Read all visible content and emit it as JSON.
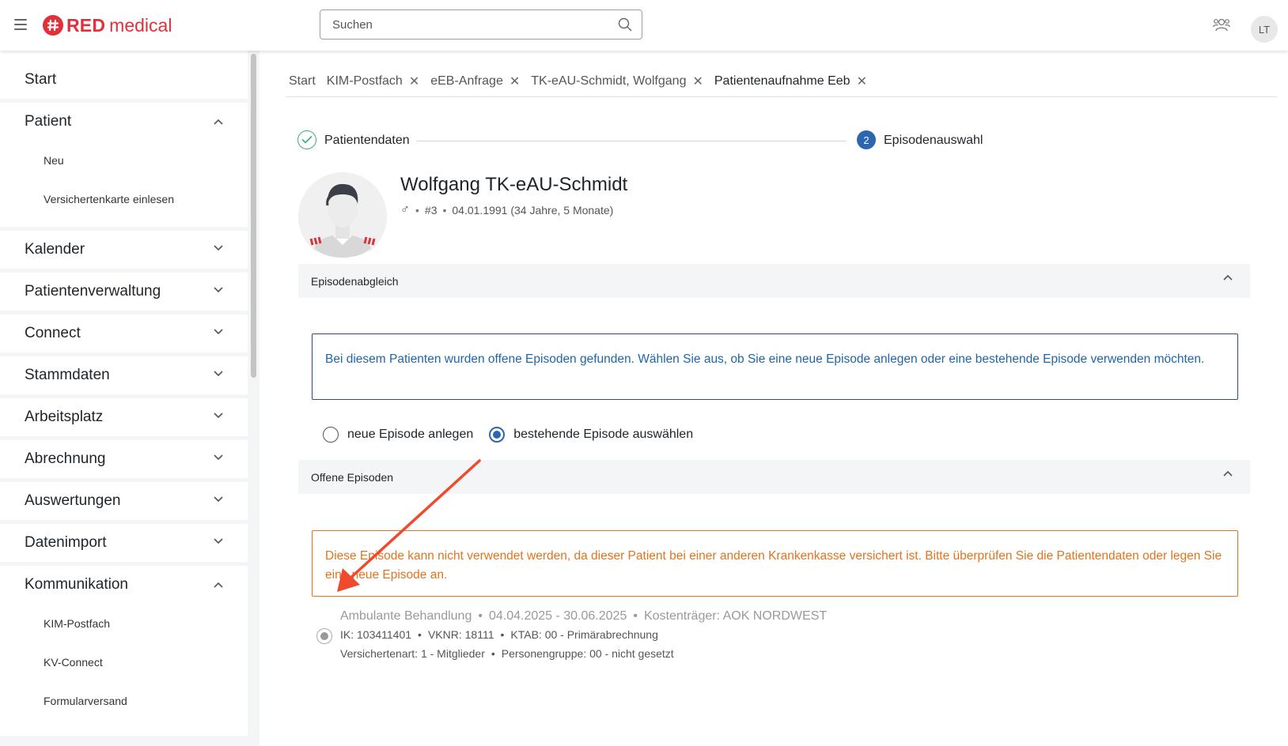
{
  "header": {
    "logo_red": "RED",
    "logo_medical": "medical",
    "search_placeholder": "Suchen",
    "user_initials": "LT"
  },
  "sidebar": {
    "start": "Start",
    "patient": "Patient",
    "patient_items": [
      "Neu",
      "Versichertenkarte einlesen"
    ],
    "sections": [
      "Kalender",
      "Patientenverwaltung",
      "Connect",
      "Stammdaten",
      "Arbeitsplatz",
      "Abrechnung",
      "Auswertungen",
      "Datenimport"
    ],
    "kommunikation": "Kommunikation",
    "kommunikation_items": [
      "KIM-Postfach",
      "KV-Connect",
      "Formularversand"
    ]
  },
  "tabs": [
    "Start",
    "KIM-Postfach",
    "eEB-Anfrage",
    "TK-eAU-Schmidt, Wolfgang",
    "Patientenaufnahme Eeb"
  ],
  "stepper": {
    "step1": "Patientendaten",
    "step2_number": "2",
    "step2": "Episodenauswahl"
  },
  "patient": {
    "name": "Wolfgang TK-eAU-Schmidt",
    "gender_symbol": "♂",
    "id": "#3",
    "birth": "04.01.1991 (34 Jahre, 5 Monate)"
  },
  "episodenabgleich": {
    "title": "Episodenabgleich",
    "info": "Bei diesem Patienten wurden offene Episoden gefunden. Wählen Sie aus, ob Sie eine neue Episode anlegen oder eine bestehende Episode verwenden möchten.",
    "option_new": "neue Episode anlegen",
    "option_existing": "bestehende Episode auswählen"
  },
  "offene_episoden": {
    "title": "Offene Episoden",
    "warning": "Diese Episode kann nicht verwendet werden, da dieser Patient bei einer anderen Krankenkasse versichert ist. Bitte überprüfen Sie die Patientendaten oder legen Sie eine neue Episode an.",
    "episode": {
      "type": "Ambulante Behandlung",
      "period": "04.04.2025 - 30.06.2025",
      "kostentraeger": "Kostenträger: AOK NORDWEST",
      "ik": "IK: 103411401",
      "vknr": "VKNR: 18111",
      "ktab": "KTAB: 00 - Primärabrechnung",
      "versichertenart": "Versichertenart: 1 - Mitglieder",
      "personengruppe": "Personengruppe: 00 - nicht gesetzt"
    }
  },
  "colors": {
    "brand": "#e0313b",
    "accent": "#2d66b0",
    "info": "#1e66a8",
    "warning": "#e0741f",
    "success": "#3fae75",
    "annotation_arrow": "#f04a2c"
  }
}
